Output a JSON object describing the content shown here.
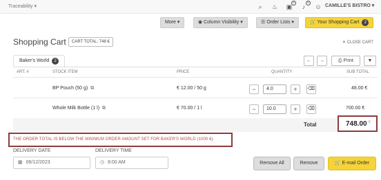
{
  "topbar": {
    "nav_label": "Traceability",
    "bistro_label": "CAMILLE'S BISTRO",
    "badges": [
      "0",
      "0"
    ]
  },
  "toolbar": {
    "more": "More",
    "column_visibility": "Column Visibility",
    "order_lists": "Order Lists",
    "your_cart": "Your Shopping Cart",
    "cart_count": "2"
  },
  "header": {
    "title": "Shopping Cart",
    "cart_total": "CART TOTAL: 748 €",
    "close_cart": "CLOSE CART"
  },
  "tab": {
    "label": "Baker's World",
    "count": "2"
  },
  "controls": {
    "print": "Print"
  },
  "table": {
    "headers": {
      "art": "ART. #",
      "stock_item": "STOCK ITEM",
      "price": "PRICE",
      "quantity": "QUANTITY",
      "sub_total": "SUB TOTAL"
    },
    "rows": [
      {
        "item": "BP Pouch (50 g)",
        "price": "€ 12.00 / 50 g",
        "qty": "4.0",
        "sub_total": "48.00 €"
      },
      {
        "item": "Whole Milk Bottle (1 l)",
        "price": "€ 70.00 / 1 l",
        "qty": "10.0",
        "sub_total": "700.00 €"
      }
    ],
    "total_label": "Total",
    "total_value": "748.00",
    "total_currency": "€"
  },
  "warning": "THE ORDER TOTAL IS BELOW THE MINIMUM ORDER AMOUNT SET FOR BAKER'S WORLD (1000 €).",
  "delivery": {
    "date_label": "DELIVERY DATE",
    "date_value": "06/12/2023",
    "time_label": "DELIVERY TIME",
    "time_value": "8:00 AM"
  },
  "actions": {
    "remove_all": "Remove All",
    "remove": "Remove",
    "email_order": "E-mail Order"
  }
}
